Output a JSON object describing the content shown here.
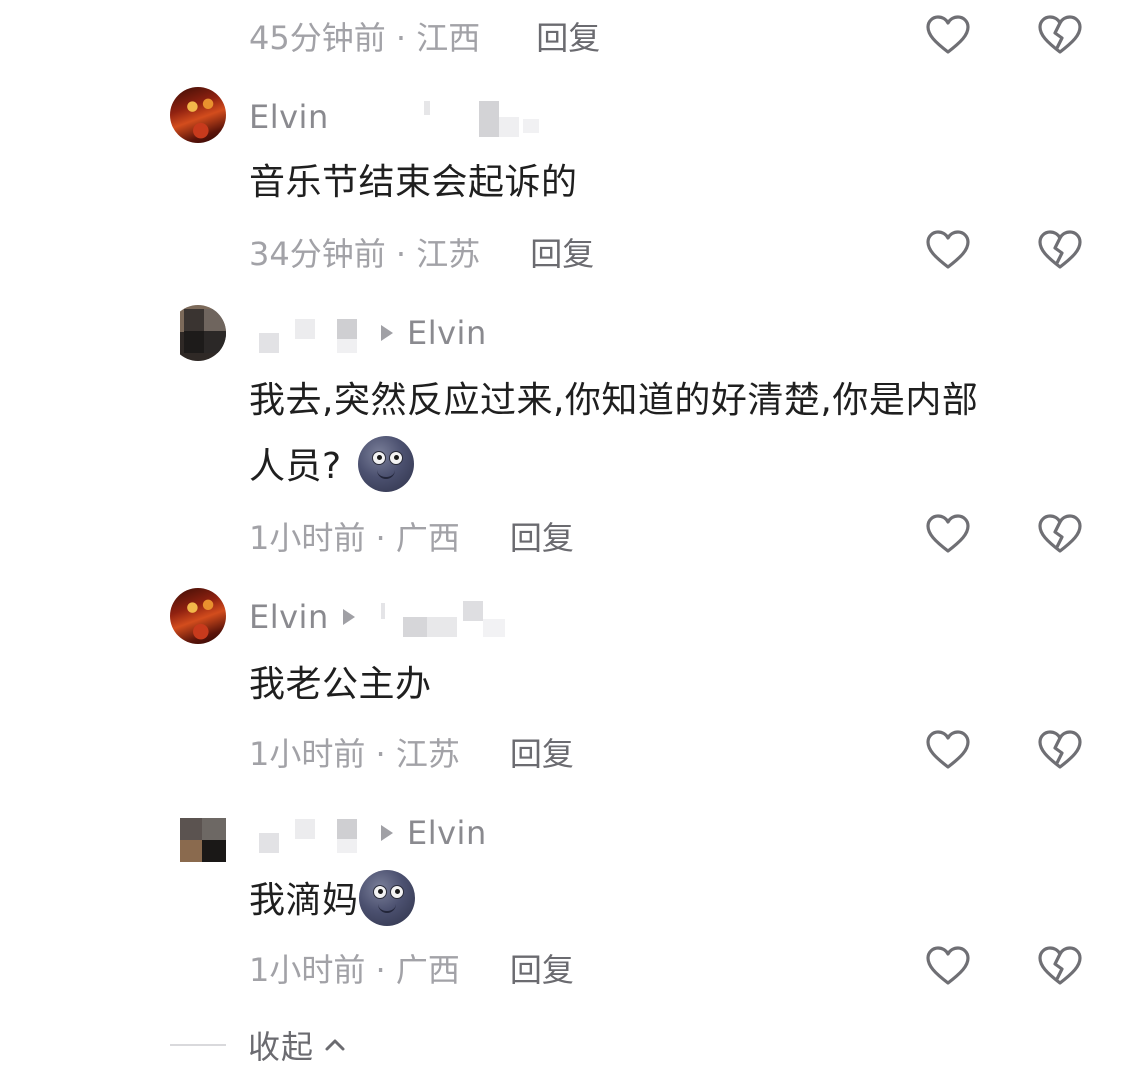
{
  "comments": [
    {
      "id": 0,
      "meta": "45分钟前 · 江西",
      "reply": "回复"
    },
    {
      "id": 1,
      "author": "Elvin",
      "text": "音乐节结束会起诉的",
      "meta": "34分钟前 · 江苏",
      "reply": "回复",
      "avatar": "red-concert-avatar"
    },
    {
      "id": 2,
      "reply_to": "Elvin",
      "text_line1": "我去,突然反应过来,你知道的好清楚,你是内部",
      "text_line2": "人员?",
      "emoji": "new-moon-face",
      "meta": "1小时前 · 广西",
      "reply": "回复",
      "avatar": "pixelated-avatar"
    },
    {
      "id": 3,
      "author": "Elvin",
      "text": "我老公主办",
      "meta": "1小时前 · 江苏",
      "reply": "回复",
      "avatar": "red-concert-avatar"
    },
    {
      "id": 4,
      "reply_to": "Elvin",
      "text": "我滴妈",
      "emoji": "new-moon-face",
      "meta": "1小时前 · 广西",
      "reply": "回复",
      "avatar": "pixelated-avatar"
    }
  ],
  "collapse_label": "收起",
  "icons": {
    "like": "heart-outline-icon",
    "dislike": "broken-heart-outline-icon",
    "collapse": "chevron-up-icon",
    "reply_arrow": "triangle-right-icon"
  },
  "colors": {
    "text": "#1f1f1f",
    "meta": "#a2a2a7",
    "name": "#8a8a8f",
    "icon_stroke": "#6f6f74"
  }
}
